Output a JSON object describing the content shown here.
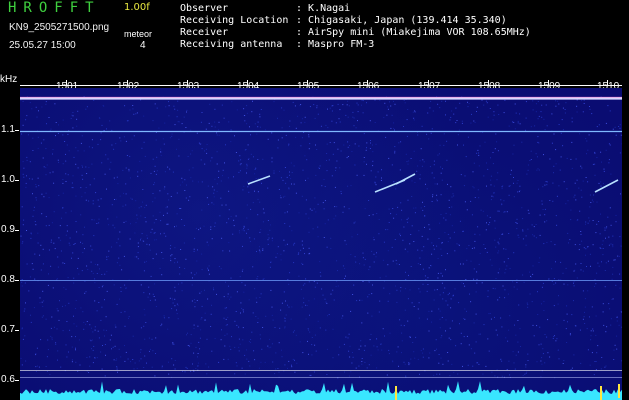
{
  "header": {
    "app_title": "HROFFT",
    "version": "1.00f",
    "filename": "KN9_2505271500.png",
    "datetime": "25.05.27 15:00",
    "meteor_label": "meteor",
    "meteor_count": "4"
  },
  "station": [
    {
      "label": "Observer",
      "value": "K.Nagai"
    },
    {
      "label": "Receiving Location",
      "value": "Chigasaki, Japan (139.414 35.340)"
    },
    {
      "label": "Receiver",
      "value": "AirSpy mini (Miakejima VOR 108.65MHz)"
    },
    {
      "label": "Receiving antenna",
      "value": "Maspro FM-3"
    }
  ],
  "axis": {
    "unit": "kHz",
    "x_ticks": [
      "1501",
      "1502",
      "1503",
      "1504",
      "1505",
      "1506",
      "1507",
      "1508",
      "1509",
      "1510"
    ],
    "y_ticks": [
      "1.1",
      "1.0",
      "0.9",
      "0.8",
      "0.7",
      "0.6"
    ]
  },
  "colors": {
    "background": "#0a0c72",
    "title_green": "#3fd03f",
    "version_yellow": "#e8e840",
    "carrier_line": "#c8c8ff",
    "pings": "#b8e0ff",
    "bottom_trace": "#39e6ff"
  }
}
